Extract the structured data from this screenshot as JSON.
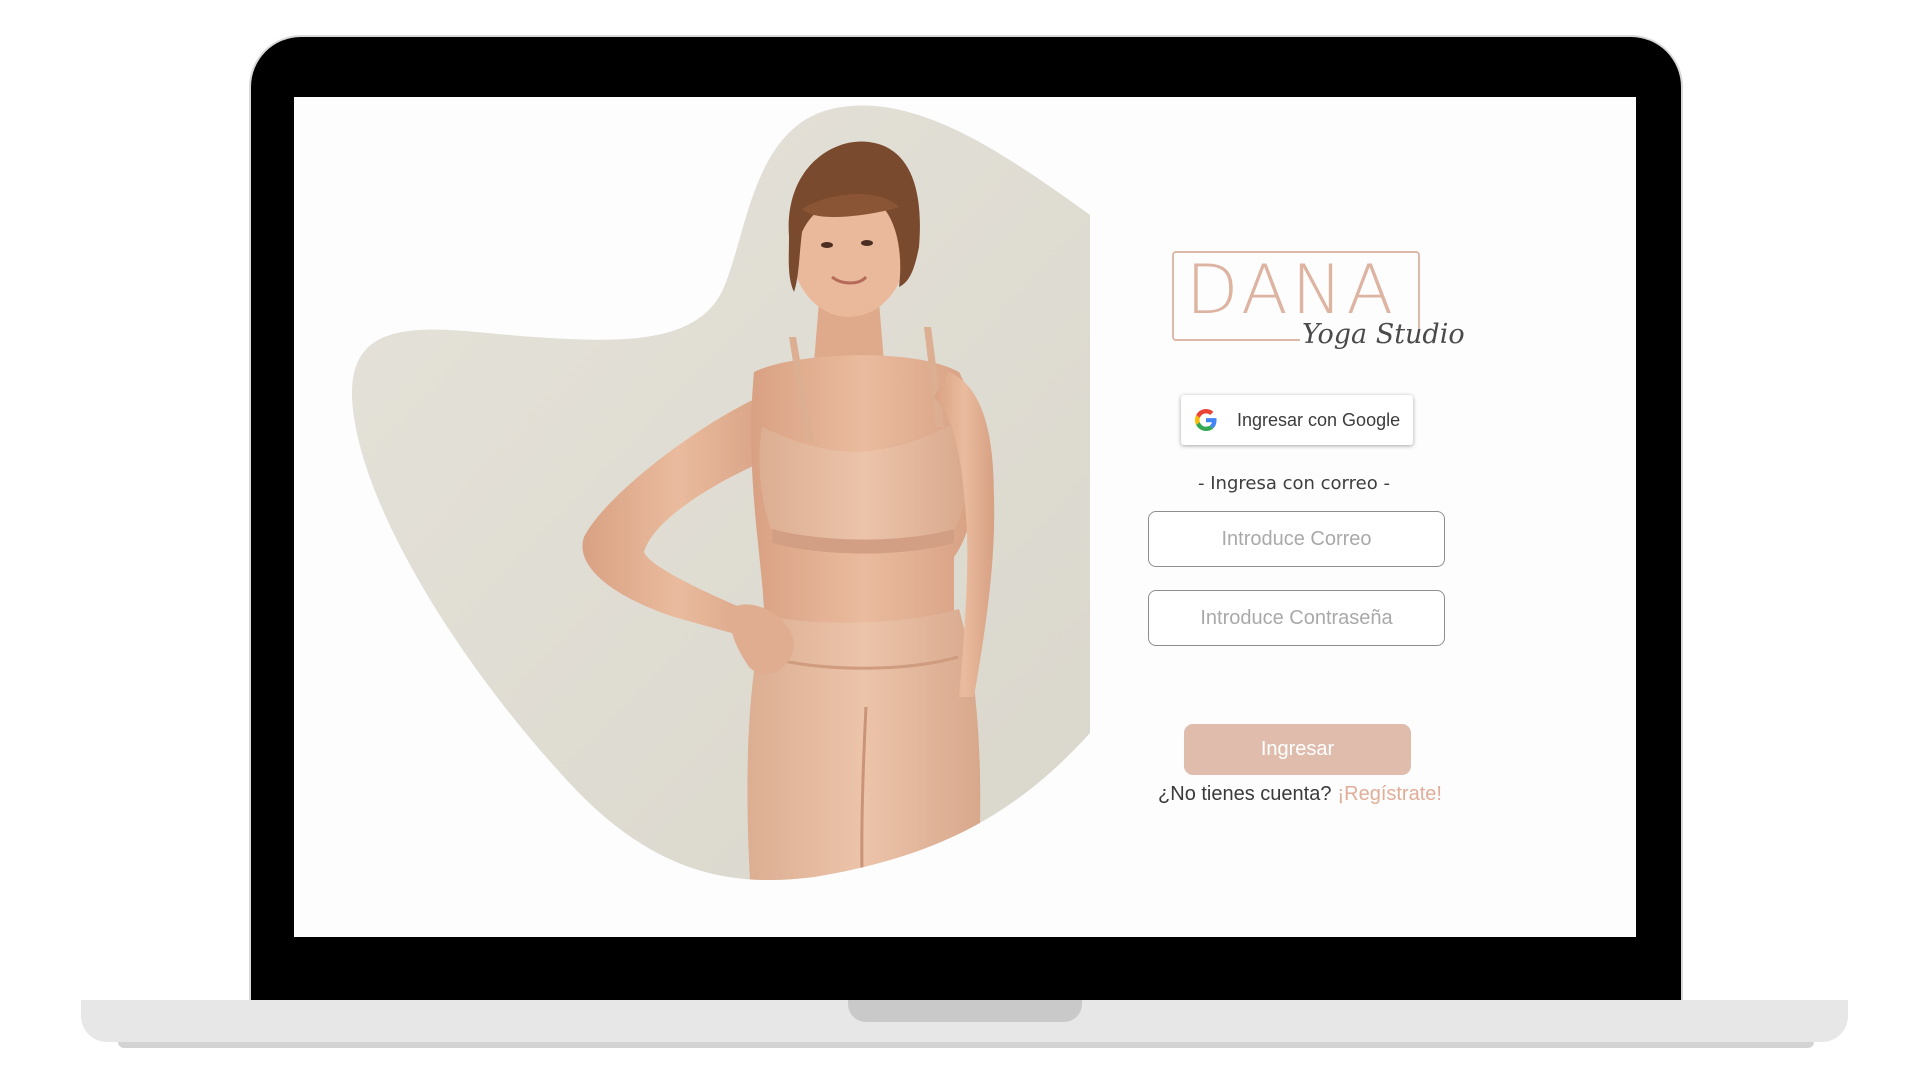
{
  "brand": {
    "name": "DANA",
    "tagline": "Yoga Studio",
    "accent_color": "#e0bcad",
    "link_color": "#e0ad98"
  },
  "hero": {
    "image_description_icon": "woman-yoga-photo"
  },
  "login": {
    "google_button_label": "Ingresar con Google",
    "google_icon": "google-g-icon",
    "divider_text": "- Ingresa con correo -",
    "email": {
      "placeholder": "Introduce Correo",
      "value": ""
    },
    "password": {
      "placeholder": "Introduce Contraseña",
      "value": ""
    },
    "submit_label": "Ingresar",
    "signup_prompt": "¿No tienes cuenta?",
    "signup_link": "¡Regístrate!"
  }
}
